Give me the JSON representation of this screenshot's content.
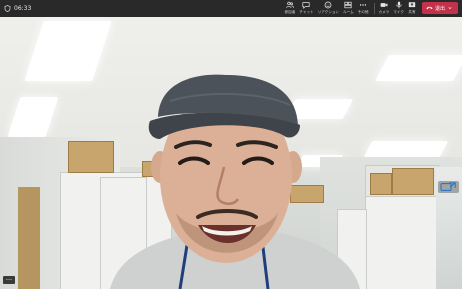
{
  "meeting": {
    "elapsed_time": "06:33"
  },
  "toolbar": {
    "items": [
      {
        "label": "参加者",
        "icon": "participants-icon"
      },
      {
        "label": "チャット",
        "icon": "chat-icon"
      },
      {
        "label": "リアクション",
        "icon": "reaction-icon"
      },
      {
        "label": "ルーム",
        "icon": "rooms-icon"
      },
      {
        "label": "その他",
        "icon": "more-icon"
      }
    ],
    "media": [
      {
        "label": "カメラ",
        "icon": "camera-icon"
      },
      {
        "label": "マイク",
        "icon": "mic-icon"
      },
      {
        "label": "共有",
        "icon": "share-icon"
      }
    ],
    "leave_label": "退出",
    "leave_color": "#c4314b"
  },
  "self_view": {
    "label": "•••"
  },
  "colors": {
    "toolbar_bg": "#292929"
  }
}
